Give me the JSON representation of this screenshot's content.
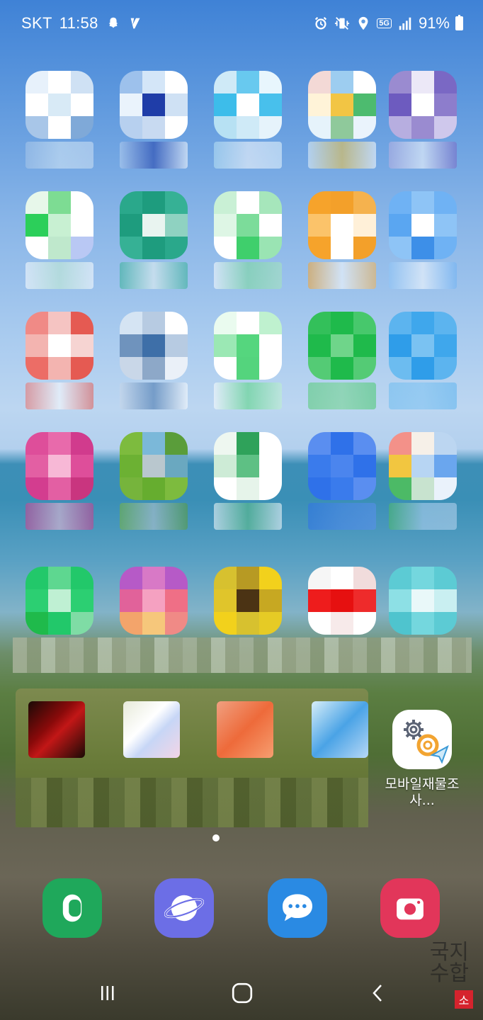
{
  "status_bar": {
    "carrier": "SKT",
    "time": "11:58",
    "network": "5G",
    "battery": "91%",
    "icons": [
      "snapchat-icon",
      "data-saver-icon",
      "alarm-icon",
      "vibrate-icon",
      "location-icon",
      "5g-icon",
      "signal-icon",
      "battery-icon"
    ]
  },
  "home_grid": {
    "rows": [
      [
        "app-1-1",
        "app-1-2",
        "app-1-3",
        "app-1-4",
        "app-1-5"
      ],
      [
        "app-2-1",
        "app-2-2",
        "app-2-3",
        "app-2-4",
        "app-2-5"
      ],
      [
        "app-3-1",
        "app-3-2",
        "app-3-3",
        "app-3-4",
        "app-3-5"
      ],
      [
        "app-4-1",
        "app-4-2",
        "app-4-3",
        "app-4-4",
        "app-4-5"
      ],
      [
        "app-5-1",
        "app-5-2",
        "app-5-3",
        "app-5-4",
        "app-5-5"
      ]
    ]
  },
  "survey_app": {
    "label_line1": "모바일재물조",
    "label_line2": "사..."
  },
  "dock": [
    "phone-icon",
    "internet-icon",
    "messages-icon",
    "camera-icon"
  ],
  "colors": {
    "phone": "#1fa85b",
    "internet": "#6c6ee6",
    "messages": "#2a8ae3",
    "camera": "#e2365a"
  },
  "watermark": {
    "line1": "국지",
    "line2": "수합",
    "badge": "소"
  }
}
